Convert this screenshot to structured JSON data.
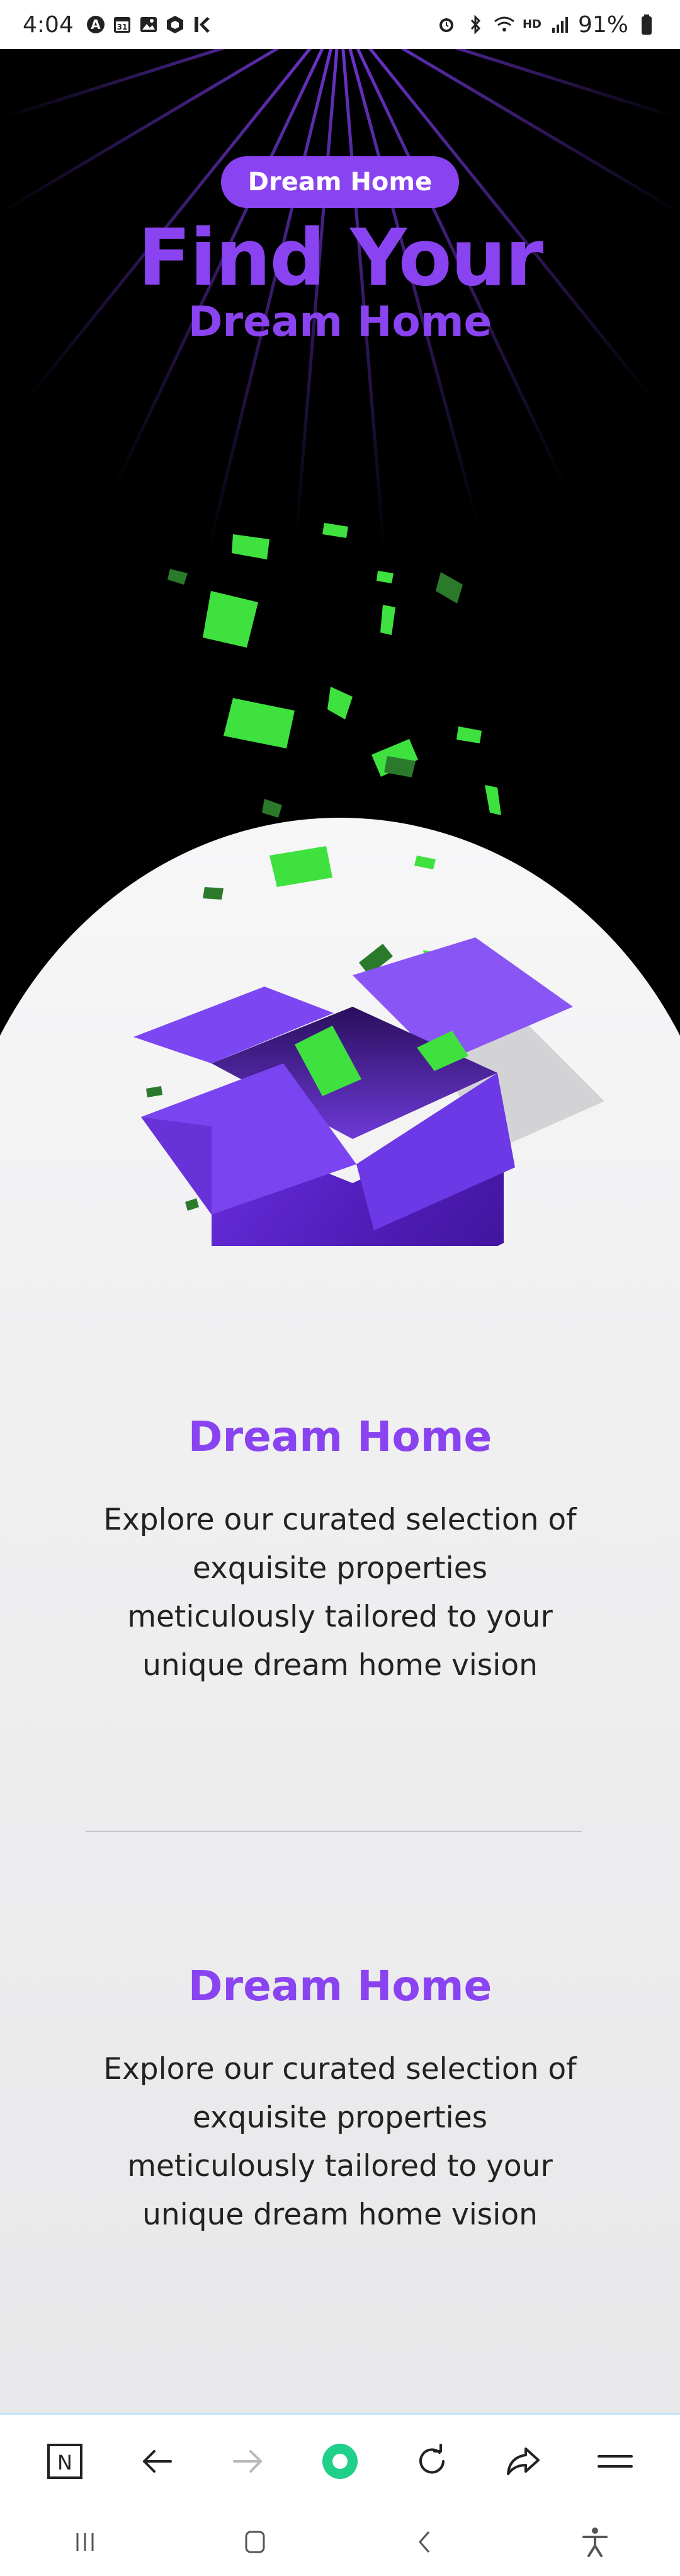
{
  "status_bar": {
    "time": "4:04",
    "battery": "91%",
    "left_icons": [
      "a-circle-icon",
      "calendar-icon",
      "gallery-icon",
      "hexagon-app-icon",
      "k-app-icon"
    ],
    "right_icons": [
      "alarm-icon",
      "bluetooth-icon",
      "wifi-icon",
      "hd-voice-icon",
      "signal-icon",
      "battery-icon"
    ],
    "hd_label": "HD"
  },
  "hero": {
    "badge": "Dream Home",
    "title": "Find Your",
    "subtitle": "Dream Home",
    "colors": {
      "accent": "#8a43f0",
      "background": "#000000",
      "money": "#3fe13f"
    }
  },
  "sections": [
    {
      "title": "Dream Home",
      "lines": [
        "Explore our curated selection of",
        "exquisite properties",
        "meticulously tailored to your",
        "unique dream home vision"
      ]
    },
    {
      "title": "Dream Home",
      "lines": [
        "Explore our curated selection of",
        "exquisite properties",
        "meticulously tailored to your",
        "unique dream home vision"
      ]
    }
  ],
  "browser_toolbar": {
    "items": [
      "n-app-icon",
      "back-arrow-icon",
      "forward-arrow-icon",
      "home-dot-icon",
      "reload-icon",
      "share-icon",
      "menu-icon"
    ],
    "n_label": "N"
  },
  "system_nav": {
    "items": [
      "recents-icon",
      "home-icon",
      "back-icon",
      "accessibility-icon"
    ]
  }
}
